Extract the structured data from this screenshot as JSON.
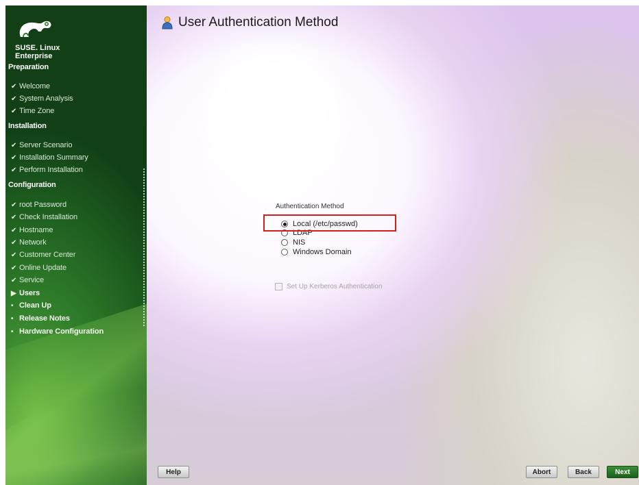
{
  "sidebar": {
    "brand": [
      "SUSE. Linux",
      "Enterprise"
    ],
    "sections": {
      "preparation": "Preparation",
      "installation": "Installation",
      "configuration": "Configuration"
    },
    "preparation_items": [
      "Welcome",
      "System Analysis",
      "Time Zone"
    ],
    "installation_items": [
      "Server Scenario",
      "Installation Summary",
      "Perform Installation"
    ],
    "configuration_items": [
      {
        "label": "root Password",
        "state": "done"
      },
      {
        "label": "Check Installation",
        "state": "done"
      },
      {
        "label": "Hostname",
        "state": "done"
      },
      {
        "label": "Network",
        "state": "done"
      },
      {
        "label": "Customer Center",
        "state": "done"
      },
      {
        "label": "Online Update",
        "state": "done"
      },
      {
        "label": "Service",
        "state": "done"
      },
      {
        "label": "Users",
        "state": "current"
      },
      {
        "label": "Clean Up",
        "state": "todo"
      },
      {
        "label": "Release Notes",
        "state": "todo"
      },
      {
        "label": "Hardware Configuration",
        "state": "todo"
      }
    ]
  },
  "main": {
    "title": "User Authentication Method",
    "group_label": "Authentication Method",
    "options": [
      {
        "label": "Local (/etc/passwd)",
        "selected": true
      },
      {
        "label": "LDAP",
        "selected": false
      },
      {
        "label": "NIS",
        "selected": false
      },
      {
        "label": "Windows Domain",
        "selected": false
      }
    ],
    "kerberos_label": "Set Up Kerberos Authentication",
    "kerberos_checked": false
  },
  "buttons": {
    "help": "Help",
    "abort": "Abort",
    "back": "Back",
    "next": "Next"
  },
  "colors": {
    "sidebar_green": "#2f7d2a",
    "highlight_red": "#d41f1f",
    "next_button": "#2a7a28"
  }
}
